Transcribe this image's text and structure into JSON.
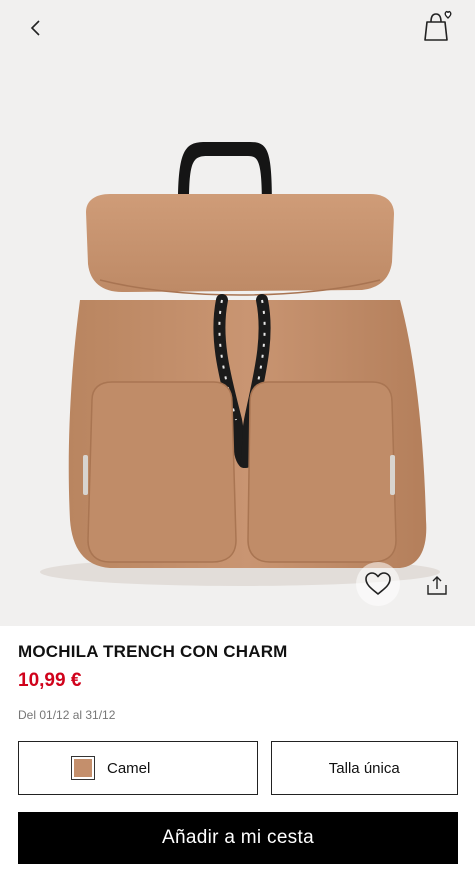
{
  "header": {
    "back_icon": "chevron-left-icon",
    "cart_icon": "shopping-bag-heart-icon"
  },
  "gallery": {
    "favorite_icon": "heart-outline-icon",
    "share_icon": "share-icon"
  },
  "product": {
    "title": "MOCHILA TRENCH CON CHARM",
    "price": "10,99 €",
    "dates": "Del 01/12 al 31/12",
    "price_color": "#d0021b"
  },
  "selectors": {
    "color_label": "Camel",
    "color_swatch": "#c48f6c",
    "size_label": "Talla única"
  },
  "actions": {
    "add_to_cart_label": "Añadir a mi cesta"
  }
}
